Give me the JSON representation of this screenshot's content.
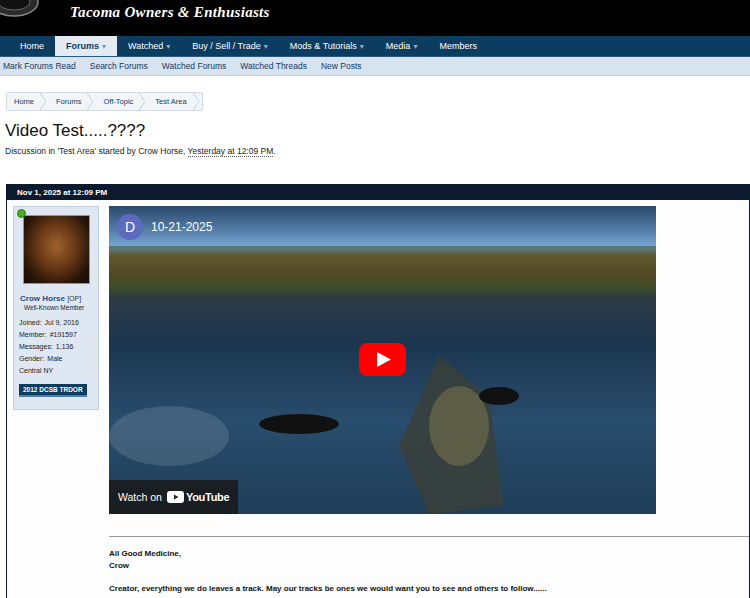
{
  "header": {
    "site_title": "Tacoma Owners & Enthusiasts"
  },
  "nav": [
    {
      "label": "Home",
      "arrow": "",
      "selected": false
    },
    {
      "label": "Forums",
      "arrow": "▾",
      "selected": true
    },
    {
      "label": "Watched",
      "arrow": "▾",
      "selected": false
    },
    {
      "label": "Buy / Sell / Trade",
      "arrow": "▾",
      "selected": false
    },
    {
      "label": "Mods & Tutorials",
      "arrow": "▾",
      "selected": false
    },
    {
      "label": "Media",
      "arrow": "▾",
      "selected": false
    },
    {
      "label": "Members",
      "arrow": "",
      "selected": false
    }
  ],
  "subnav": [
    "Mark Forums Read",
    "Search Forums",
    "Watched Forums",
    "Watched Threads",
    "New Posts"
  ],
  "breadcrumb": [
    "Home",
    "Forums",
    "Off-Topic",
    "Test Area"
  ],
  "thread": {
    "title": "Video Test.....????",
    "meta_prefix": "Discussion in 'Test Area' started by Crow Horse, ",
    "meta_time": "Yesterday at 12:09 PM",
    "meta_suffix": "."
  },
  "post": {
    "date": "Nov 1, 2025 at 12:09 PM",
    "user": {
      "name": "Crow Horse",
      "op_tag": "[OP]",
      "title": "Well-Known Member",
      "online": true,
      "stats": [
        {
          "label": "Joined:",
          "value": "Jul 9, 2016"
        },
        {
          "label": "Member:",
          "value": "#191597"
        },
        {
          "label": "Messages:",
          "value": "1,136"
        },
        {
          "label": "Gender:",
          "value": "Male"
        },
        {
          "label": "",
          "value": "Central NY"
        }
      ],
      "badge": "2012 DCSB TRDOR"
    },
    "video": {
      "channel_initial": "D",
      "title": "10-21-2025",
      "watch_label": "Watch on",
      "brand": "YouTube"
    },
    "signature": [
      "All Good Medicine,",
      "Crow"
    ],
    "quote": "Creator, everything we do leaves a track. May our tracks be ones we would want you to see and others to follow......"
  }
}
